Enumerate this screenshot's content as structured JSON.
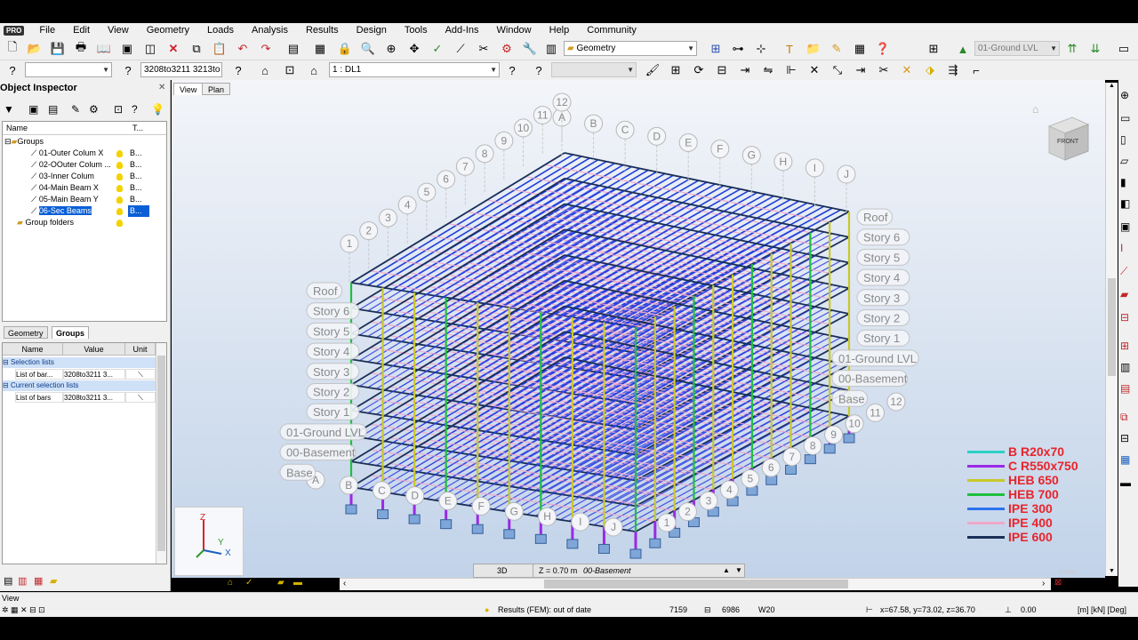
{
  "menu": {
    "badge": "PRO",
    "items": [
      "File",
      "Edit",
      "View",
      "Geometry",
      "Loads",
      "Analysis",
      "Results",
      "Design",
      "Tools",
      "Add-Ins",
      "Window",
      "Help",
      "Community"
    ]
  },
  "toolbar": {
    "layout_combo": "Geometry",
    "level_combo": "01-Ground LVL",
    "selection_combo": "",
    "bars_combo": "3208to3211 3213to",
    "case_combo": "1 : DL1",
    "disabled_combo": ""
  },
  "object_inspector": {
    "title": "Object Inspector",
    "columns": {
      "name": "Name",
      "type": "T..."
    },
    "root": "Groups",
    "groups": [
      {
        "label": "01-Outer Colum X",
        "type": "B..."
      },
      {
        "label": "02-OOuter Colum ...",
        "type": "B..."
      },
      {
        "label": "03-Inner Colum",
        "type": "B..."
      },
      {
        "label": "04-Main Beam X",
        "type": "B..."
      },
      {
        "label": "05-Main Beam Y",
        "type": "B..."
      },
      {
        "label": "06-Sec Beams",
        "type": "B...",
        "selected": true
      }
    ],
    "folders": "Group folders",
    "tabs": [
      "Geometry",
      "Groups"
    ],
    "active_tab": "Groups",
    "props_columns": {
      "name": "Name",
      "value": "Value",
      "unit": "Unit"
    },
    "props": [
      {
        "section": "Selection lists"
      },
      {
        "name": "List of bar...",
        "value": "3208to3211 3..."
      },
      {
        "section": "Current selection lists"
      },
      {
        "name": "List of bars",
        "value": "3208to3211 3..."
      }
    ]
  },
  "view_tabs": [
    "View",
    "Plan"
  ],
  "active_view_tab": "View",
  "view_bar": {
    "mode": "3D",
    "level": "Z = 0.70 m",
    "level_name": "00-Basement"
  },
  "cube": {
    "front": "FRONT",
    "right": "RIGHT"
  },
  "axis": {
    "z": "Z",
    "y": "Y",
    "x": "X"
  },
  "legend": [
    {
      "label": "B R20x70",
      "color": "#2bd1c4"
    },
    {
      "label": "C R550x750",
      "color": "#9b29e6"
    },
    {
      "label": "HEB 650",
      "color": "#c8c82a"
    },
    {
      "label": "HEB 700",
      "color": "#1fbf3e"
    },
    {
      "label": "IPE 300",
      "color": "#2b73ee"
    },
    {
      "label": "IPE 400",
      "color": "#f0a8c8"
    },
    {
      "label": "IPE 600",
      "color": "#1a2f56"
    }
  ],
  "grid_letters_top": [
    "A",
    "B",
    "C",
    "D",
    "E",
    "F",
    "G",
    "H",
    "I",
    "J"
  ],
  "grid_numbers_top": [
    "1",
    "2",
    "3",
    "4",
    "5",
    "6",
    "7",
    "8",
    "9",
    "10",
    "11",
    "12"
  ],
  "grid_letters_bottom": [
    "A",
    "B",
    "C",
    "D",
    "E",
    "F",
    "G",
    "H",
    "I",
    "J"
  ],
  "grid_numbers_bottom": [
    "1",
    "2",
    "3",
    "4",
    "5",
    "6",
    "7",
    "8",
    "9",
    "10",
    "11",
    "12"
  ],
  "stories_right": [
    "Roof",
    "Story 6",
    "Story 5",
    "Story 4",
    "Story 3",
    "Story 2",
    "Story 1",
    "01-Ground LVL",
    "00-Basement",
    "Base"
  ],
  "stories_left": [
    "Roof",
    "Story 6",
    "Story 5",
    "Story 4",
    "Story 3",
    "Story 2",
    "Story 1",
    "01-Ground LVL",
    "00-Basement",
    "Base"
  ],
  "status": {
    "view": "View",
    "results": "Results (FEM): out of date",
    "nodes": "7159",
    "bars": "6986",
    "section": "W20",
    "coords": "x=67.58, y=73.02, z=36.70",
    "angle": "0.00",
    "units": "[m] [kN] [Deg]"
  },
  "watermark": "View"
}
